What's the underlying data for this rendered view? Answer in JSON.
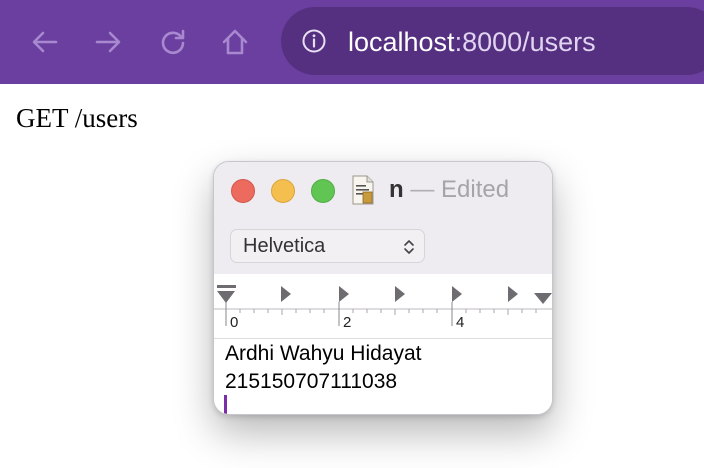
{
  "browser": {
    "url_host": "localhost",
    "url_path": ":8000/users",
    "icons": {
      "back": "arrow-left-icon",
      "forward": "arrow-right-icon",
      "reload": "reload-icon",
      "home": "home-icon",
      "site_info": "info-circle-icon"
    },
    "colors": {
      "toolbar": "#6b3fa0",
      "address_bar": "#563080"
    }
  },
  "page": {
    "body_text": "GET /users"
  },
  "textedit": {
    "title_name": "n",
    "title_separator": "—",
    "title_status": "Edited",
    "font_name": "Helvetica",
    "ruler_labels": [
      "0",
      "2",
      "4"
    ],
    "content_lines": [
      "Ardhi Wahyu Hidayat",
      "215150707111038"
    ],
    "colors": {
      "close": "#ec6a5e",
      "minimize": "#f5bf4f",
      "maximize": "#61c554",
      "caret": "#7a2fa8"
    }
  }
}
